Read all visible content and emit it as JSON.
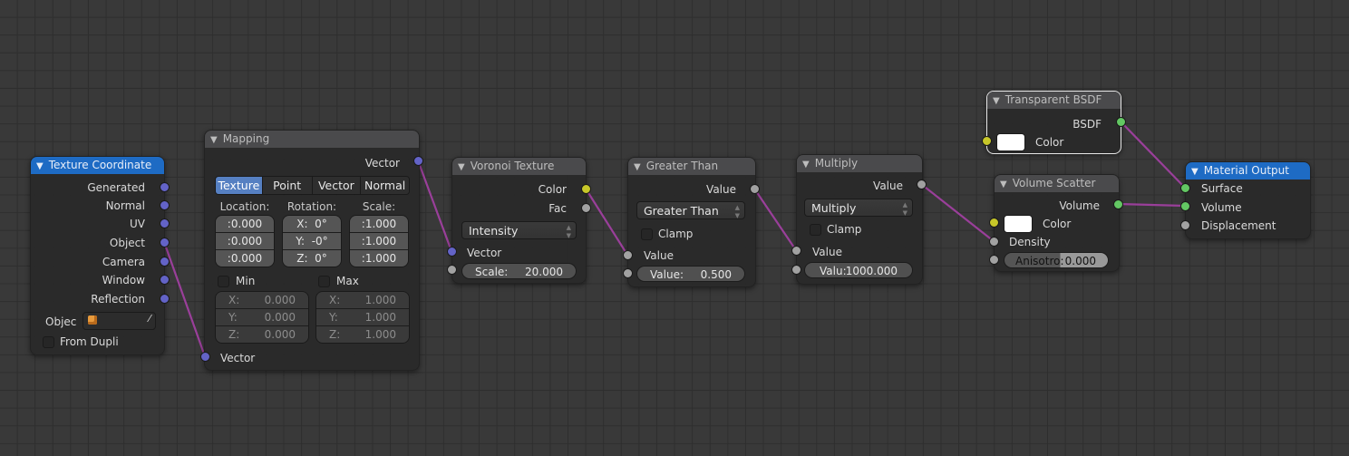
{
  "colors": {
    "vector_socket": "#6363c7",
    "value_socket": "#a1a1a1",
    "color_socket": "#c7c729",
    "shader_socket": "#63c763",
    "link": "#9a3f9a",
    "header_blue": "#1e6bc4",
    "background": "#393939"
  },
  "nodes": {
    "texture_coordinate": {
      "title": "Texture Coordinate",
      "outputs": [
        "Generated",
        "Normal",
        "UV",
        "Object",
        "Camera",
        "Window",
        "Reflection"
      ],
      "object_label": "Objec",
      "object_value": "",
      "from_dupli_label": "From Dupli",
      "from_dupli_checked": false
    },
    "mapping": {
      "title": "Mapping",
      "output": "Vector",
      "tabs": [
        "Texture",
        "Point",
        "Vector",
        "Normal"
      ],
      "active_tab": "Texture",
      "location_label": "Location:",
      "rotation_label": "Rotation:",
      "scale_label": "Scale:",
      "location": [
        ":0.000",
        ":0.000",
        ":0.000"
      ],
      "rotation": [
        {
          "k": "X:",
          "v": "0°"
        },
        {
          "k": "Y:",
          "v": "-0°"
        },
        {
          "k": "Z:",
          "v": "0°"
        }
      ],
      "scale": [
        ":1.000",
        ":1.000",
        ":1.000"
      ],
      "min_label": "Min",
      "max_label": "Max",
      "min": [
        {
          "k": "X:",
          "v": "0.000"
        },
        {
          "k": "Y:",
          "v": "0.000"
        },
        {
          "k": "Z:",
          "v": "0.000"
        }
      ],
      "max": [
        {
          "k": "X:",
          "v": "1.000"
        },
        {
          "k": "Y:",
          "v": "1.000"
        },
        {
          "k": "Z:",
          "v": "1.000"
        }
      ],
      "input": "Vector"
    },
    "voronoi": {
      "title": "Voronoi Texture",
      "outputs": [
        "Color",
        "Fac"
      ],
      "coloring": "Intensity",
      "input_vector": "Vector",
      "scale_label": "Scale:",
      "scale_value": "20.000"
    },
    "greater_than": {
      "title": "Greater Than",
      "output": "Value",
      "operation": "Greater Than",
      "clamp_label": "Clamp",
      "input_value": "Value",
      "value_label": "Value:",
      "value": "0.500"
    },
    "multiply": {
      "title": "Multiply",
      "output": "Value",
      "operation": "Multiply",
      "clamp_label": "Clamp",
      "input_value": "Value",
      "value_label": "Valu:",
      "value": "1000.000"
    },
    "transparent_bsdf": {
      "title": "Transparent BSDF",
      "output": "BSDF",
      "color_label": "Color",
      "color_value": "#ffffff"
    },
    "volume_scatter": {
      "title": "Volume Scatter",
      "output": "Volume",
      "color_label": "Color",
      "color_value": "#ffffff",
      "density_label": "Density",
      "anisotropy_label": "Anisotro:",
      "anisotropy_value": "0.000"
    },
    "material_output": {
      "title": "Material Output",
      "inputs": [
        "Surface",
        "Volume",
        "Displacement"
      ]
    }
  }
}
